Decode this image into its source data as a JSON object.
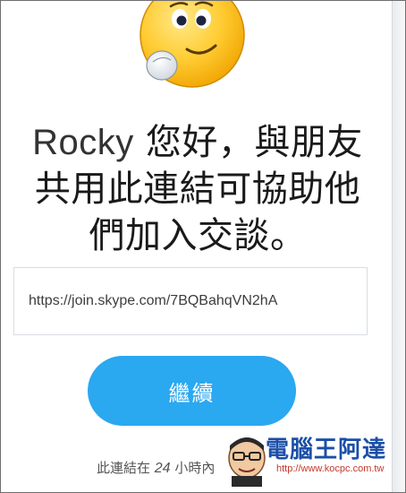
{
  "invite": {
    "headline_name": "Rocky",
    "headline_line1_rest": " 您好，與朋友",
    "headline_line2": "共用此連結可協助他",
    "headline_line3": "們加入交談。",
    "link_url": "https://join.skype.com/7BQBahqVN2hA",
    "continue_label": "繼續",
    "footnote_prefix": "此連結在 ",
    "footnote_number": "24",
    "footnote_suffix": " 小時內",
    "emoji_icon": "skype-smiley-thinking-icon"
  },
  "watermark": {
    "title": "電腦王阿達",
    "url": "http://www.kocpc.com.tw"
  },
  "colors": {
    "accent": "#2aa8f0",
    "text": "#1a1a1a",
    "border": "#d8dde2",
    "watermark_title": "#1b4fa8",
    "watermark_url": "#c0392b"
  }
}
